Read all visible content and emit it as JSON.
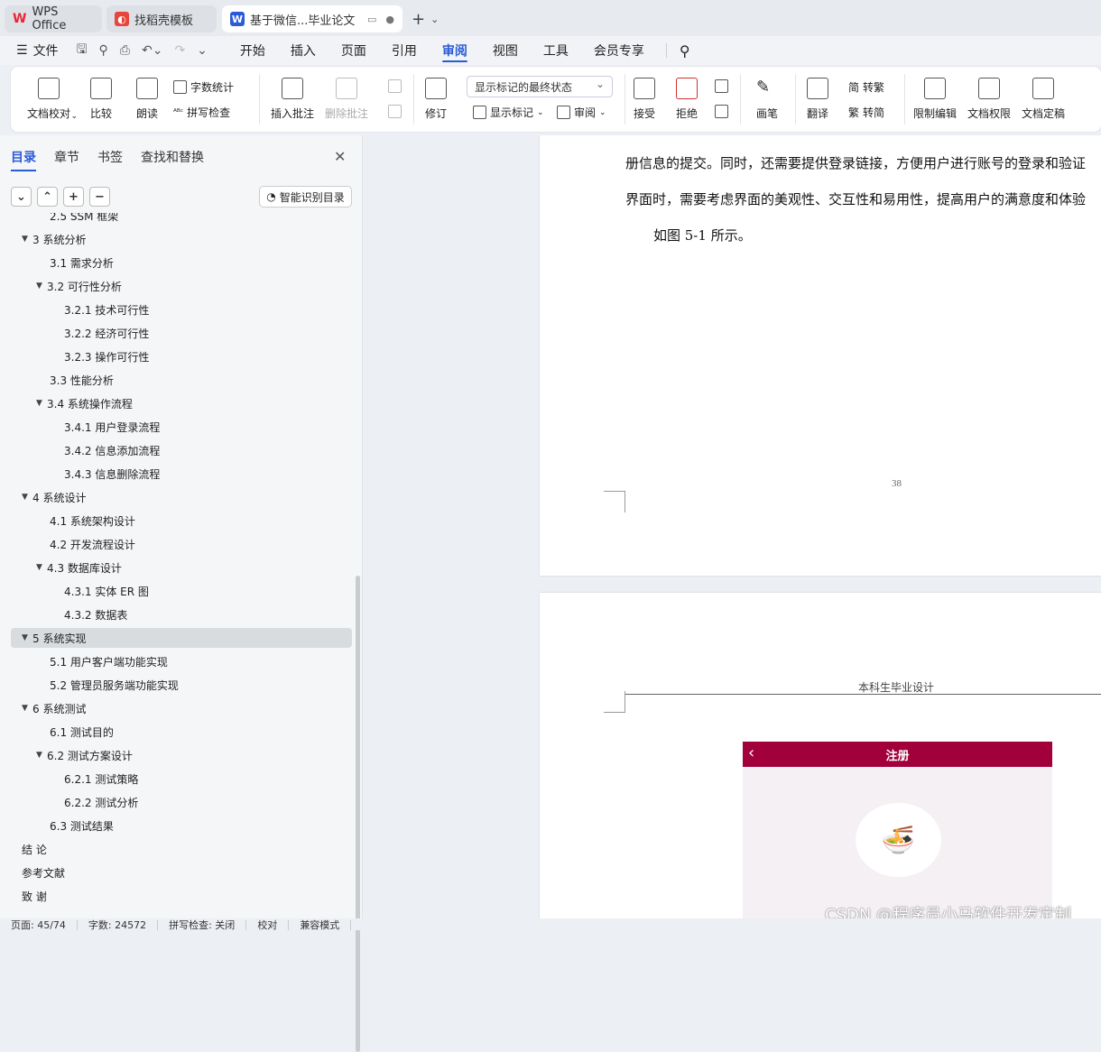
{
  "tabs": [
    {
      "label": "WPS Office",
      "icon": "wps-logo-icon"
    },
    {
      "label": "找稻壳模板",
      "icon": "docer-icon"
    },
    {
      "label": "基于微信...毕业论文",
      "icon": "word-doc-icon"
    }
  ],
  "menu": {
    "file": "文件",
    "items": [
      "开始",
      "插入",
      "页面",
      "引用",
      "审阅",
      "视图",
      "工具",
      "会员专享"
    ],
    "selected": "审阅"
  },
  "ribbon": {
    "doc_check": "文档校对",
    "compare": "比较",
    "read_aloud": "朗读",
    "word_count": "字数统计",
    "spell_check": "拼写检查",
    "insert_comment": "插入批注",
    "delete_comment": "删除批注",
    "revise": "修订",
    "display_state": "显示标记的最终状态",
    "show_markup": "显示标记",
    "review": "审阅",
    "accept": "接受",
    "reject": "拒绝",
    "pen": "画笔",
    "translate": "翻译",
    "to_traditional": "转繁",
    "to_simplified": "转简",
    "restrict_edit": "限制编辑",
    "doc_permission": "文档权限",
    "finalize": "文档定稿"
  },
  "left_panel": {
    "tabs": [
      "目录",
      "章节",
      "书签",
      "查找和替换"
    ],
    "smart_toc": "智能识别目录",
    "toc": [
      {
        "label": "2.5 SSM 框架",
        "level": 2,
        "arrow": ""
      },
      {
        "label": "3  系统分析",
        "level": 1,
        "arrow": "▼"
      },
      {
        "label": "3.1 需求分析",
        "level": 2,
        "arrow": ""
      },
      {
        "label": "3.2 可行性分析",
        "level": 2,
        "arrow": "▼"
      },
      {
        "label": "3.2.1 技术可行性",
        "level": 3,
        "arrow": ""
      },
      {
        "label": "3.2.2 经济可行性",
        "level": 3,
        "arrow": ""
      },
      {
        "label": "3.2.3 操作可行性",
        "level": 3,
        "arrow": ""
      },
      {
        "label": "3.3 性能分析",
        "level": 2,
        "arrow": ""
      },
      {
        "label": "3.4 系统操作流程",
        "level": 2,
        "arrow": "▼"
      },
      {
        "label": "3.4.1 用户登录流程",
        "level": 3,
        "arrow": ""
      },
      {
        "label": "3.4.2 信息添加流程",
        "level": 3,
        "arrow": ""
      },
      {
        "label": "3.4.3 信息删除流程",
        "level": 3,
        "arrow": ""
      },
      {
        "label": "4  系统设计",
        "level": 1,
        "arrow": "▼"
      },
      {
        "label": "4.1 系统架构设计",
        "level": 2,
        "arrow": ""
      },
      {
        "label": "4.2 开发流程设计",
        "level": 2,
        "arrow": ""
      },
      {
        "label": "4.3 数据库设计",
        "level": 2,
        "arrow": "▼"
      },
      {
        "label": "4.3.1 实体 ER 图",
        "level": 3,
        "arrow": ""
      },
      {
        "label": "4.3.2 数据表",
        "level": 3,
        "arrow": ""
      },
      {
        "label": "5  系统实现",
        "level": 1,
        "arrow": "▼",
        "selected": true
      },
      {
        "label": "5.1 用户客户端功能实现",
        "level": 2,
        "arrow": ""
      },
      {
        "label": "5.2  管理员服务端功能实现",
        "level": 2,
        "arrow": ""
      },
      {
        "label": "6  系统测试",
        "level": 1,
        "arrow": "▼"
      },
      {
        "label": "6.1  测试目的",
        "level": 2,
        "arrow": ""
      },
      {
        "label": "6.2  测试方案设计",
        "level": 2,
        "arrow": "▼"
      },
      {
        "label": "6.2.1  测试策略",
        "level": 3,
        "arrow": ""
      },
      {
        "label": "6.2.2  测试分析",
        "level": 3,
        "arrow": ""
      },
      {
        "label": "6.3  测试结果",
        "level": 2,
        "arrow": ""
      },
      {
        "label": "结    论",
        "level": 1,
        "arrow": ""
      },
      {
        "label": "参考文献",
        "level": 1,
        "arrow": ""
      },
      {
        "label": "致    谢",
        "level": 1,
        "arrow": ""
      }
    ]
  },
  "document": {
    "line1": "册信息的提交。同时，还需要提供登录链接，方便用户进行账号的登录和验证",
    "line2": "界面时，需要考虑界面的美观性、交互性和易用性，提高用户的满意度和体验",
    "line3": "如图 5-1 所示。",
    "page_number": "38",
    "header": "本科生毕业设计",
    "phone_title": "注册"
  },
  "watermark": "CSDN @程序员小马软件开发定制",
  "status": {
    "page": "页面: 45/74",
    "words": "字数: 24572",
    "spell": "拼写检查: 关闭",
    "proof": "校对",
    "compat": "兼容模式"
  }
}
